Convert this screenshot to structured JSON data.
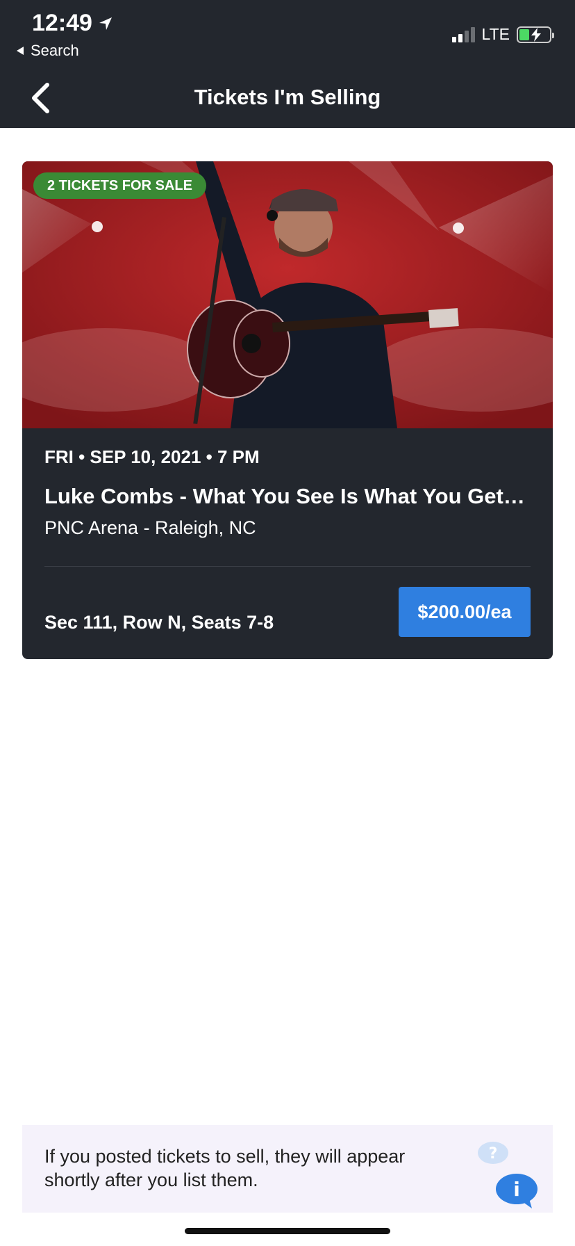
{
  "status_bar": {
    "time": "12:49",
    "back_label": "Search",
    "network": "LTE"
  },
  "nav": {
    "title": "Tickets I'm Selling"
  },
  "listing": {
    "badge": "2 TICKETS FOR SALE",
    "date": "FRI • SEP 10, 2021 • 7 PM",
    "event_name": "Luke Combs - What You See Is What You Get Tour",
    "venue": "PNC Arena - Raleigh, NC",
    "seats": "Sec 111, Row N, Seats 7-8",
    "price": "$200.00/ea"
  },
  "notice": {
    "text": "If you posted tickets to sell, they will appear shortly after you list them."
  },
  "colors": {
    "header_bg": "#23272e",
    "badge_green": "#3a8a35",
    "price_blue": "#2f7fe0",
    "notice_bg": "#f5f2fb"
  }
}
